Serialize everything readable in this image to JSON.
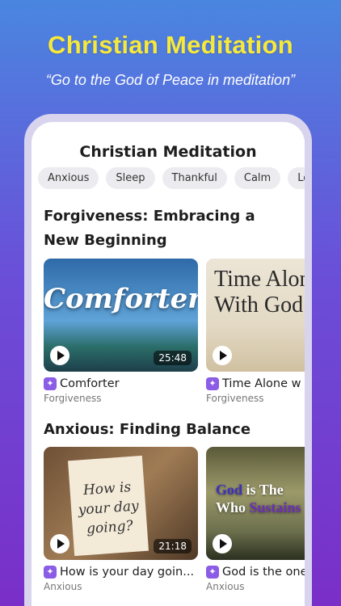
{
  "promo": {
    "headline": "Christian Meditation",
    "subline": "“Go to the God of Peace in meditation”"
  },
  "app": {
    "title": "Christian Meditation",
    "chips": [
      "Anxious",
      "Sleep",
      "Thankful",
      "Calm",
      "Lo"
    ]
  },
  "sections": [
    {
      "title": "Forgiveness: Embracing a New Beginning",
      "cards": [
        {
          "title": "Comforter",
          "category": "Forgiveness",
          "duration": "25:48",
          "art_text": "Comforter"
        },
        {
          "title": "Time Alone w",
          "category": "Forgiveness",
          "duration": "",
          "art_text_line1": "Time Alone",
          "art_text_line2": "With God"
        }
      ]
    },
    {
      "title": "Anxious: Finding Balance",
      "cards": [
        {
          "title": "How is your day goin...",
          "category": "Anxious",
          "duration": "21:18",
          "art_text_line1": "How is",
          "art_text_line2": "your day",
          "art_text_line3": "going?"
        },
        {
          "title": "God is the one",
          "category": "Anxious",
          "duration": "",
          "art_text_line1a": "God",
          "art_text_line1b": " is The",
          "art_text_line2a": "Who ",
          "art_text_line2b": "Sustains"
        }
      ]
    }
  ],
  "icons": {
    "play": "play-icon",
    "sparkle": "sparkle-icon"
  },
  "colors": {
    "headline": "#f7e93a",
    "accent": "#8b5ce6"
  }
}
